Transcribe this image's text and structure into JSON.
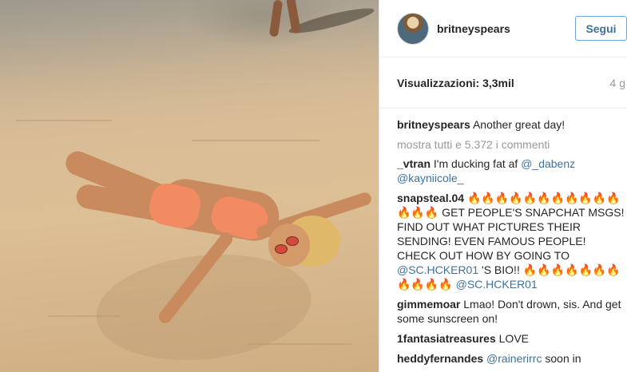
{
  "post": {
    "username": "britneyspears",
    "follow_label": "Segui",
    "views_label": "Visualizzazioni: 3,3mil",
    "time_ago": "4 g",
    "caption": {
      "user": "britneyspears",
      "text": "Another great day!"
    },
    "show_all_comments": "mostra tutti e 5.372 i commenti"
  },
  "comments": [
    {
      "user": "_vtran",
      "text": "I'm ducking fat af ",
      "mention1": "@_dabenz",
      "mention2": "@kayniicole_"
    },
    {
      "user": "snapsteal.04",
      "text": "🔥🔥🔥🔥🔥🔥🔥🔥🔥🔥🔥🔥🔥🔥 GET PEOPLE'S SNAPCHAT MSGS! FIND OUT WHAT PICTURES THEIR SENDING! EVEN FAMOUS PEOPLE! CHECK OUT HOW BY GOING TO ",
      "mention1": "@SC.HCKER01",
      "text2": " 'S BIO!! 🔥🔥🔥🔥🔥🔥🔥🔥🔥🔥🔥 ",
      "mention2": "@SC.HCKER01"
    },
    {
      "user": "gimmemoar",
      "text": "Lmao! Don't drown, sis. And get some sunscreen on!"
    },
    {
      "user": "1fantasiatreasures",
      "text": "LOVE"
    },
    {
      "user": "heddyfernandes",
      "mention1": "@rainerirrc",
      "text": " soon in"
    }
  ]
}
